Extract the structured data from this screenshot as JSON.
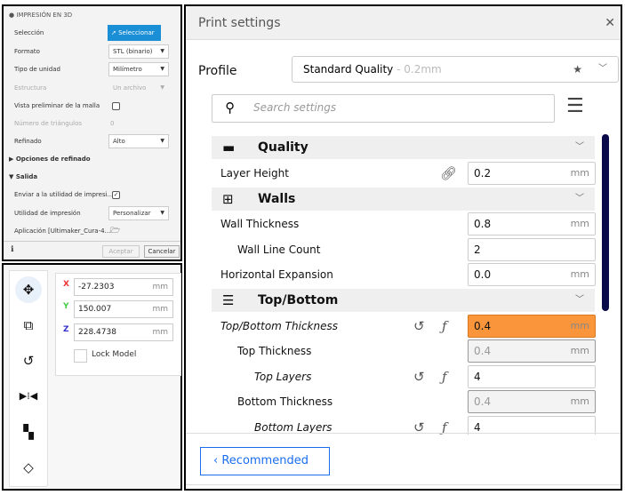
{
  "export_panel": {
    "title": "IMPRESIÓN EN 3D",
    "rows": [
      {
        "label": "Selección",
        "button": "Seleccionar"
      },
      {
        "label": "Formato",
        "value": "STL (binario)"
      },
      {
        "label": "Tipo de unidad",
        "value": "Milímetro"
      },
      {
        "label": "Estructura",
        "value": "Un archivo"
      },
      {
        "label": "Vista preliminar de la malla",
        "checked": false
      },
      {
        "label": "Número de triángulos",
        "value": "0"
      },
      {
        "label": "Refinado",
        "value": "Alto"
      }
    ],
    "refine_options": "Opciones de refinado",
    "output": "Salida",
    "send_label": "Enviar a la utilidad de impresi...",
    "send_checked": true,
    "utility_label": "Utilidad de impresión",
    "utility_value": "Personalizar",
    "app_label": "Aplicación [Ultimaker_Cura-4...",
    "accept": "Aceptar",
    "cancel": "Cancelar",
    "accent": "#1a8fd6"
  },
  "move_panel": {
    "x": "-27.2303",
    "y": "150.007",
    "z": "228.4738",
    "unit": "mm",
    "x_label": "X",
    "y_label": "Y",
    "z_label": "Z",
    "lock_model": "Lock Model",
    "tools": [
      "move-icon",
      "scale-icon",
      "rotate-icon",
      "mirror-icon",
      "per-model-settings-icon",
      "support-blocker-icon"
    ]
  },
  "print_settings": {
    "title": "Print settings",
    "profile_label": "Profile",
    "profile_name": "Standard Quality",
    "profile_detail": " - 0.2mm",
    "search_placeholder": "Search settings",
    "categories": {
      "quality": "Quality",
      "walls": "Walls",
      "topbottom": "Top/Bottom"
    },
    "settings": {
      "layer_height": {
        "label": "Layer Height",
        "value": "0.2",
        "unit": "mm"
      },
      "wall_thickness": {
        "label": "Wall Thickness",
        "value": "0.8",
        "unit": "mm"
      },
      "wall_line_count": {
        "label": "Wall Line Count",
        "value": "2"
      },
      "horizontal_expansion": {
        "label": "Horizontal Expansion",
        "value": "0.0",
        "unit": "mm"
      },
      "tb_thickness": {
        "label": "Top/Bottom Thickness",
        "value": "0.4",
        "unit": "mm"
      },
      "top_thickness": {
        "label": "Top Thickness",
        "value": "0.4",
        "unit": "mm"
      },
      "top_layers": {
        "label": "Top Layers",
        "value": "4"
      },
      "bottom_thickness": {
        "label": "Bottom Thickness",
        "value": "0.4",
        "unit": "mm"
      },
      "bottom_layers": {
        "label": "Bottom Layers",
        "value": "4"
      }
    },
    "recommended": "Recommended",
    "highlight_color": "#fa953b",
    "accent": "#196ef0"
  }
}
